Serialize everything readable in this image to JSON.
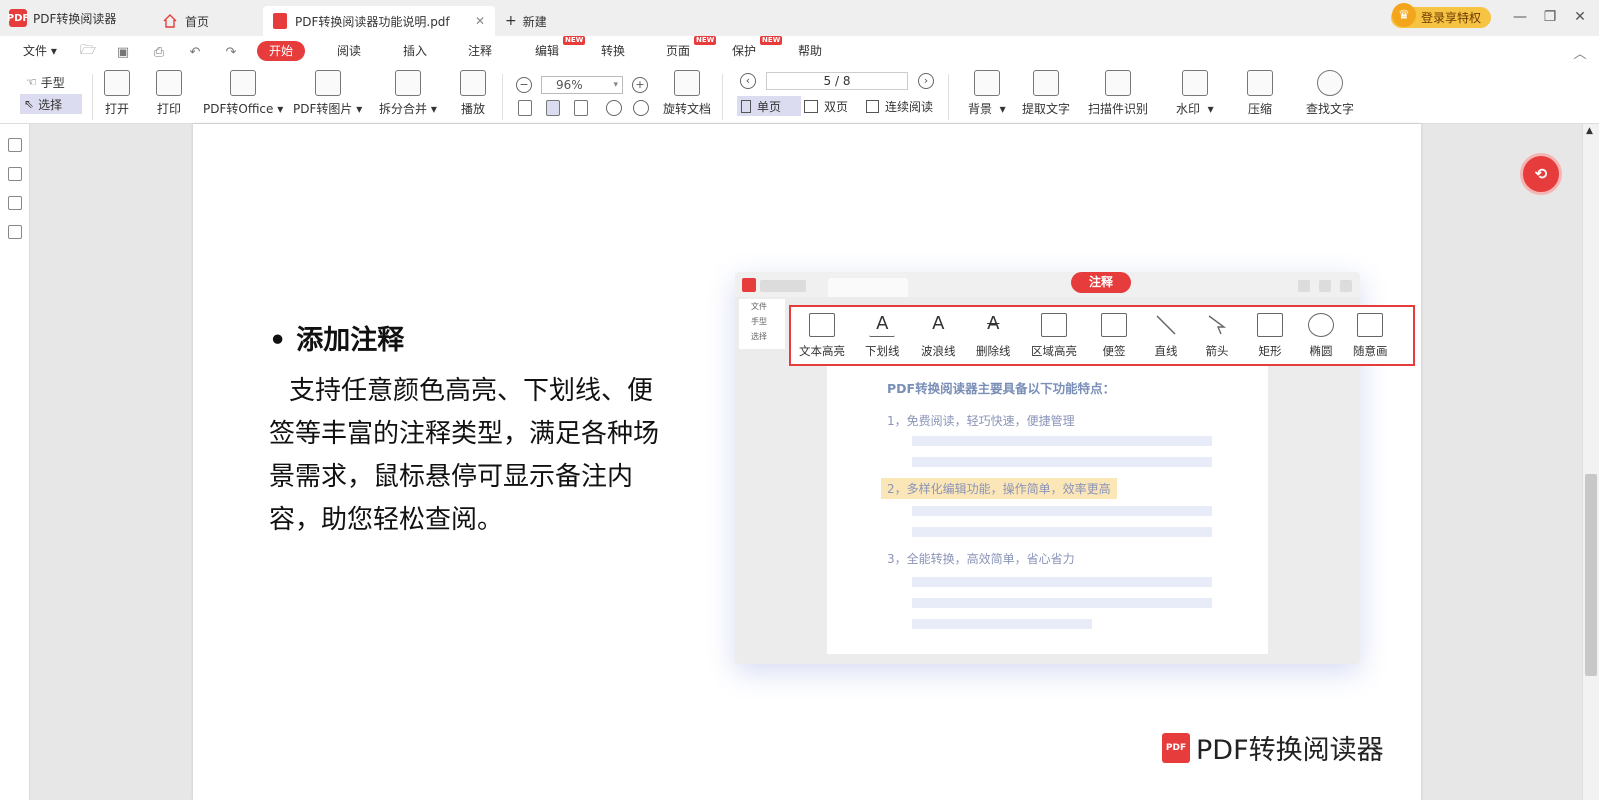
{
  "app": {
    "title": "PDF转换阅读器",
    "logo_text": "PDF"
  },
  "tabs": [
    {
      "label": "首页"
    },
    {
      "label": "PDF转换阅读器功能说明.pdf",
      "close": "✕"
    },
    {
      "label": "新建",
      "prefix": "+"
    }
  ],
  "vip": {
    "label": "登录享特权"
  },
  "window_controls": {
    "minimize": "—",
    "restore": "❐",
    "close": "✕"
  },
  "menu": {
    "file": "文件",
    "items": [
      {
        "label": "开始",
        "active": true
      },
      {
        "label": "阅读"
      },
      {
        "label": "插入"
      },
      {
        "label": "注释"
      },
      {
        "label": "编辑",
        "badge": "NEW"
      },
      {
        "label": "转换"
      },
      {
        "label": "页面",
        "badge": "NEW"
      },
      {
        "label": "保护",
        "badge": "NEW"
      },
      {
        "label": "帮助"
      }
    ]
  },
  "ribbon": {
    "hand": "手型",
    "select": "选择",
    "open": "打开",
    "print": "打印",
    "pdf_to_office": "PDF转Office",
    "pdf_to_image": "PDF转图片",
    "split_merge": "拆分合并",
    "play": "播放",
    "zoom": "96%",
    "rotate_doc": "旋转文档",
    "page_indicator": "5 / 8",
    "single_page": "单页",
    "double_page": "双页",
    "continuous": "连续阅读",
    "background": "背景",
    "extract_text": "提取文字",
    "scan_ocr": "扫描件识别",
    "watermark": "水印",
    "compress": "压缩",
    "find_text": "查找文字"
  },
  "content": {
    "heading": "添加注释",
    "bullet": "•",
    "body": "支持任意颜色高亮、下划线、便签等丰富的注释类型，满足各种场景需求，鼠标悬停可显示备注内容，助您轻松查阅。"
  },
  "mock": {
    "pill": "注释",
    "side": [
      "文件",
      "手型",
      "选择"
    ],
    "tools": [
      "文本高亮",
      "下划线",
      "波浪线",
      "删除线",
      "区域高亮",
      "便签",
      "直线",
      "箭头",
      "矩形",
      "椭圆",
      "随意画"
    ],
    "doc": {
      "title": "PDF转换阅读器主要具备以下功能特点：",
      "line1": "1，免费阅读，轻巧快速，便捷管理",
      "line2": "2，多样化编辑功能，操作简单，效率更高",
      "line3": "3，全能转换，高效简单，省心省力"
    }
  },
  "brand": {
    "text": "PDF转换阅读器",
    "logo_text": "PDF"
  },
  "colors": {
    "accent": "#e63c3c",
    "vip": "#f6c343"
  }
}
